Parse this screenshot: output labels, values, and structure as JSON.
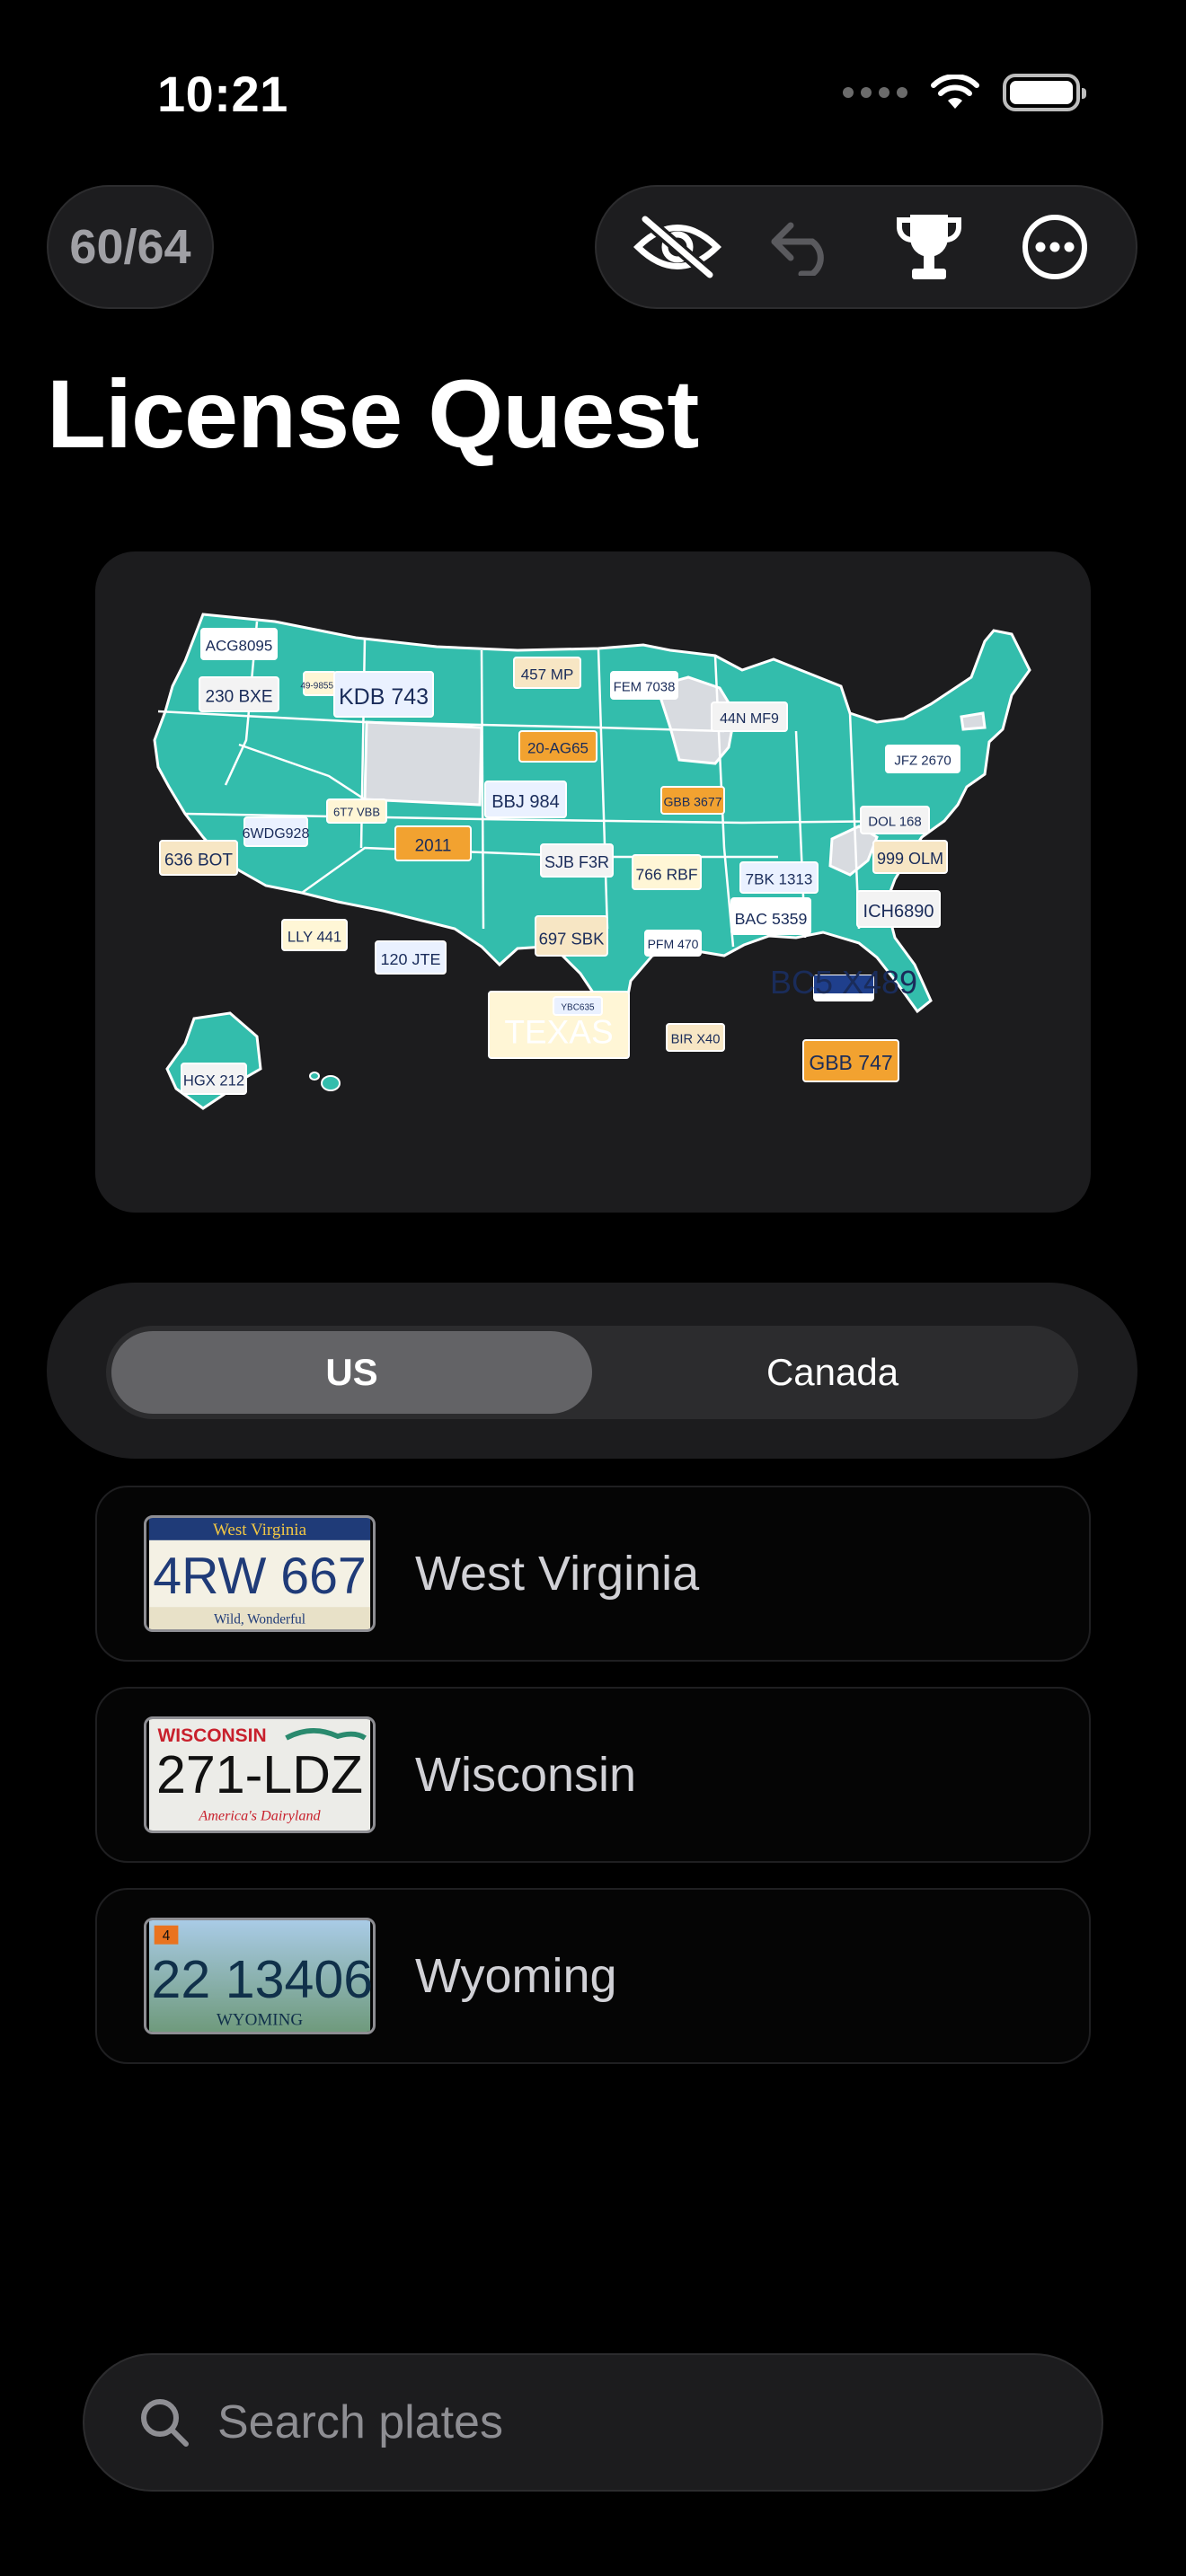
{
  "status_bar": {
    "time": "10:21"
  },
  "header": {
    "counter": "60/64",
    "title": "License Quest"
  },
  "toolbar": {
    "icons": [
      "eye-slash-icon",
      "undo-icon",
      "trophy-icon",
      "more-icon"
    ]
  },
  "map": {
    "plate_labels": [
      "ACG8095",
      "230 BXE",
      "49-9855A",
      "KDB 743",
      "457 MP",
      "FEM 7038",
      "44N MF9",
      "20-AG65",
      "BBJ 984",
      "GBB 3677",
      "JFZ 2670",
      "DOL 168",
      "6T7 VBB",
      "6WDG928",
      "636 BOT",
      "2011",
      "SJB F3R",
      "766 RBF",
      "7BK 1313",
      "999 OLM",
      "BAC 5359",
      "ICH6890",
      "LLY 441",
      "120 JTE",
      "697 SBK",
      "PFM 470",
      "BC5 X489",
      "TEXAS",
      "YBC635",
      "BIR X40",
      "GBB 747",
      "HGX 212"
    ],
    "colors": {
      "collected": "#33bdac",
      "missing": "#d8dbe0",
      "card": "#1c1c1e"
    }
  },
  "segmented": {
    "options": [
      "US",
      "Canada"
    ],
    "selected": "US"
  },
  "list": [
    {
      "name": "West Virginia",
      "plate_text": "4RW 667",
      "plate_header": "West Virginia",
      "plate_footer": "Wild, Wonderful"
    },
    {
      "name": "Wisconsin",
      "plate_text": "271-LDZ",
      "plate_header": "WISCONSIN",
      "plate_footer": "America's Dairyland"
    },
    {
      "name": "Wyoming",
      "plate_text": "22 13406",
      "plate_header": "4",
      "plate_footer": "WYOMING"
    }
  ],
  "search": {
    "placeholder": "Search plates"
  }
}
